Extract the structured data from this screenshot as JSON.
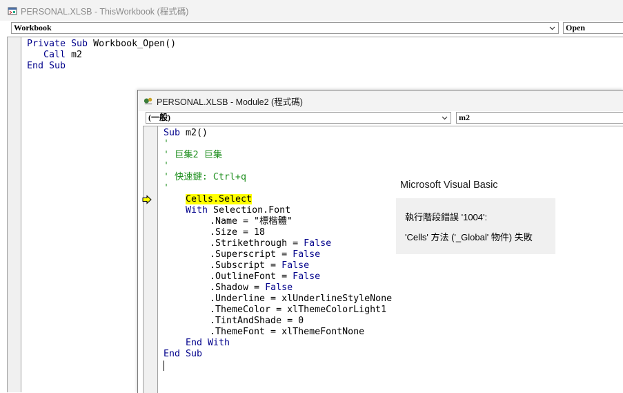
{
  "window1": {
    "title": "PERSONAL.XLSB - ThisWorkbook (程式碼)",
    "object_combo": "Workbook",
    "proc_combo": "Open",
    "code": {
      "l1_kw1": "Private Sub",
      "l1_rest": " Workbook_Open()",
      "l2_kw": "Call",
      "l2_rest": " m2",
      "l3_kw": "End Sub"
    }
  },
  "window2": {
    "title": "PERSONAL.XLSB - Module2 (程式碼)",
    "object_combo": "(一般)",
    "proc_combo": "m2",
    "code": {
      "sub_kw": "Sub",
      "sub_rest": " m2()",
      "c1": "'",
      "c2": "' 巨集2 巨集",
      "c3": "'",
      "c4": "' 快速鍵: Ctrl+q",
      "c5": "'",
      "select": "Cells.Select",
      "with_kw": "With",
      "with_rest": " Selection.Font",
      "name": ".Name = \"標楷體\"",
      "size": ".Size = 18",
      "strike_a": ".Strikethrough = ",
      "super_a": ".Superscript = ",
      "sub_a": ".Subscript = ",
      "outline_a": ".OutlineFont = ",
      "shadow_a": ".Shadow = ",
      "false_kw": "False",
      "underline": ".Underline = xlUnderlineStyleNone",
      "themecolor": ".ThemeColor = xlThemeColorLight1",
      "tint": ".TintAndShade = 0",
      "themefont": ".ThemeFont = xlThemeFontNone",
      "endwith_kw": "End With",
      "endsub_kw": "End Sub"
    }
  },
  "dialog": {
    "title": "Microsoft Visual Basic",
    "line1": "執行階段錯誤 '1004':",
    "line2": "'Cells' 方法 ('_Global' 物件) 失敗"
  },
  "colors": {
    "keyword": "#00008b",
    "comment": "#1f8f1f",
    "highlight": "#ffff00"
  }
}
